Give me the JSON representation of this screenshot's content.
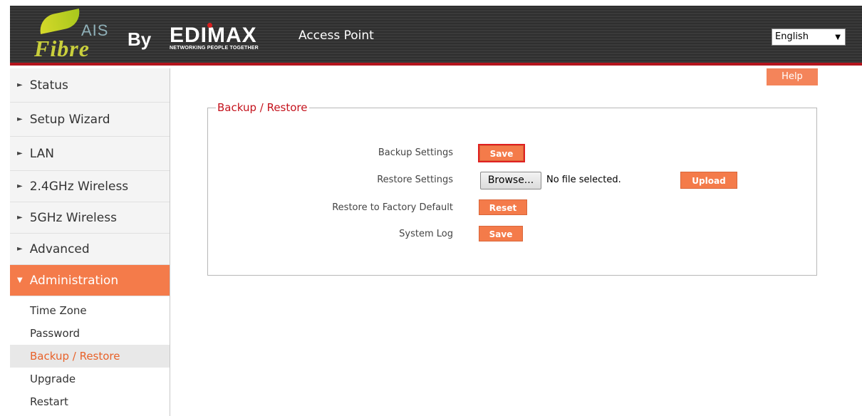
{
  "header": {
    "logo_ais": "AIS",
    "logo_fibre": "Fibre",
    "by": "By",
    "brand": "EDIMAX",
    "brand_tagline": "NETWORKING PEOPLE TOGETHER",
    "title": "Access Point",
    "language": "English"
  },
  "sidebar": {
    "items": [
      {
        "label": "Status"
      },
      {
        "label": "Setup Wizard"
      },
      {
        "label": "LAN"
      },
      {
        "label": "2.4GHz Wireless"
      },
      {
        "label": "5GHz Wireless"
      },
      {
        "label": "Advanced"
      },
      {
        "label": "Administration"
      }
    ],
    "sub_items": [
      {
        "label": "Time Zone"
      },
      {
        "label": "Password"
      },
      {
        "label": "Backup / Restore"
      },
      {
        "label": "Upgrade"
      },
      {
        "label": "Restart"
      }
    ]
  },
  "main": {
    "help_label": "Help",
    "section_title": "Backup / Restore",
    "backup_label": "Backup Settings",
    "backup_button": "Save",
    "restore_label": "Restore Settings",
    "browse_button": "Browse...",
    "file_status": "No file selected.",
    "upload_button": "Upload",
    "factory_label": "Restore to Factory Default",
    "reset_button": "Reset",
    "syslog_label": "System Log",
    "syslog_button": "Save"
  },
  "colors": {
    "accent": "#f47b4a",
    "header_bg": "#333333",
    "header_border": "#b3141c",
    "section_title": "#c4121c"
  }
}
